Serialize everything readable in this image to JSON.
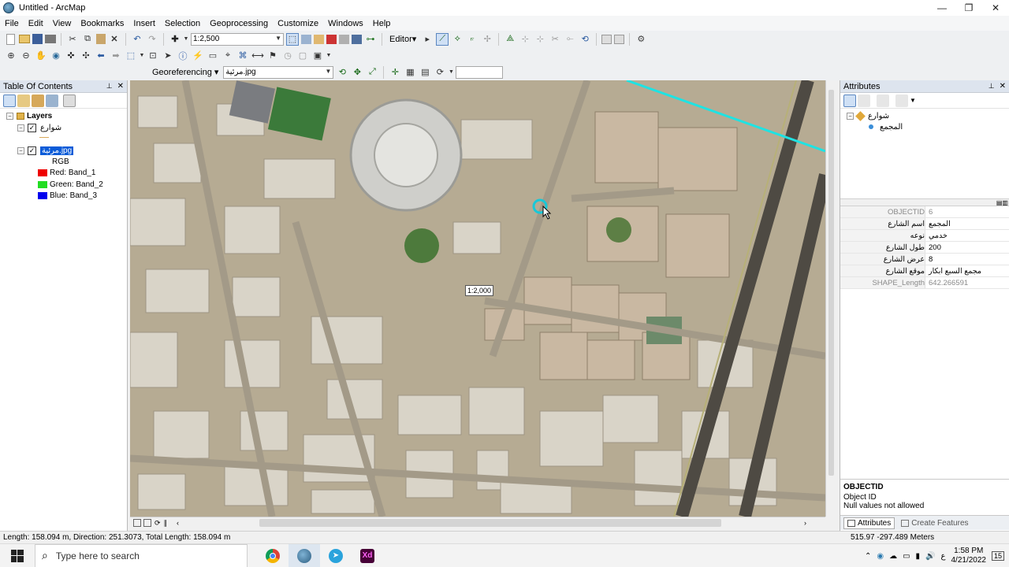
{
  "window": {
    "title": "Untitled - ArcMap",
    "minimize": "—",
    "maximize": "❐",
    "close": "✕"
  },
  "menu": [
    "File",
    "Edit",
    "View",
    "Bookmarks",
    "Insert",
    "Selection",
    "Geoprocessing",
    "Customize",
    "Windows",
    "Help"
  ],
  "toolbar1": {
    "scale": "1:2,500",
    "editor_label": "Editor▾"
  },
  "toolbar3": {
    "georef_label": "Georeferencing ▾",
    "layer_combo": "مرئية.jpg",
    "search_box": ""
  },
  "toc": {
    "title": "Table Of Contents",
    "pin": "📌",
    "close": "✕",
    "root": "Layers",
    "layer1": "شوارع",
    "layer2": "مرئية.jpg",
    "rgb": "RGB",
    "bands": [
      {
        "label": "Red:",
        "band": "Band_1",
        "color": "#ff0000"
      },
      {
        "label": "Green:",
        "band": "Band_2",
        "color": "#22dd22"
      },
      {
        "label": "Blue:",
        "band": "Band_3",
        "color": "#0000ff"
      }
    ]
  },
  "map": {
    "scale_tip": "1:2,000"
  },
  "attributes": {
    "title": "Attributes",
    "tree_layer": "شوارع",
    "tree_feature": "المجمع",
    "rows": [
      {
        "key": "OBJECTID",
        "value": "6",
        "readonly": true
      },
      {
        "key": "اسم الشارع",
        "value": "المجمع",
        "readonly": false
      },
      {
        "key": "نوعه",
        "value": "خدمي",
        "readonly": false
      },
      {
        "key": "طول الشارع",
        "value": "200",
        "readonly": false
      },
      {
        "key": "عرض الشارع",
        "value": "8",
        "readonly": false
      },
      {
        "key": "موقع الشارع",
        "value": "مجمع السبع ابكار",
        "readonly": false
      },
      {
        "key": "SHAPE_Length",
        "value": "642.266591",
        "readonly": true
      }
    ],
    "desc_title": "OBJECTID",
    "desc_line1": "Object ID",
    "desc_line2": "Null values not allowed",
    "tab_attributes": "Attributes",
    "tab_create": "Create Features"
  },
  "status": {
    "left": "Length: 158.094 m, Direction: 251.3073, Total Length: 158.094 m",
    "coords": "515.97  -297.489 Meters"
  },
  "taskbar": {
    "search": "Type here to search",
    "time": "1:58 PM",
    "date": "4/21/2022",
    "lang": "ع",
    "notif": "15"
  }
}
